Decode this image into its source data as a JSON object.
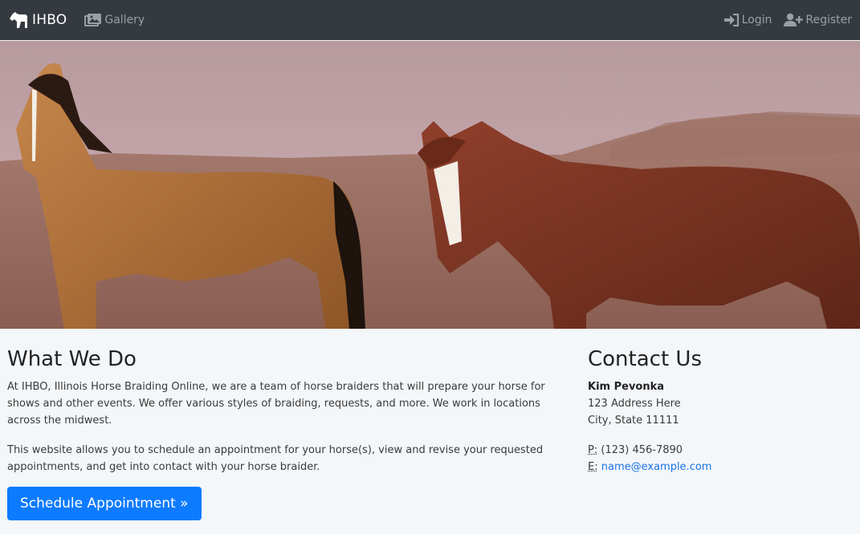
{
  "nav": {
    "brand": "IHBO",
    "gallery": "Gallery",
    "login": "Login",
    "register": "Register"
  },
  "hero": {
    "image": "two horses standing on a desert plain under a pink sky"
  },
  "main": {
    "title": "What We Do",
    "p1": "At IHBO, Illinois Horse Braiding Online, we are a team of horse braiders that will prepare your horse for shows and other events. We offer various styles of braiding, requests, and more. We work in locations across the midwest.",
    "p2": "This website allows you to schedule an appointment for your horse(s), view and revise your requested appointments, and get into contact with your horse braider.",
    "button": "Schedule Appointment »"
  },
  "contact": {
    "title": "Contact Us",
    "name": "Kim Pevonka",
    "address1": "123 Address Here",
    "address2": "City, State 11111",
    "phone_label": "P:",
    "phone": "(123) 456-7890",
    "email_label": "E:",
    "email": "name@example.com"
  },
  "colors": {
    "navbar": "#343a40",
    "page_bg": "#f4f7fa",
    "button": "#0d7bff",
    "link": "#1a73e8"
  }
}
